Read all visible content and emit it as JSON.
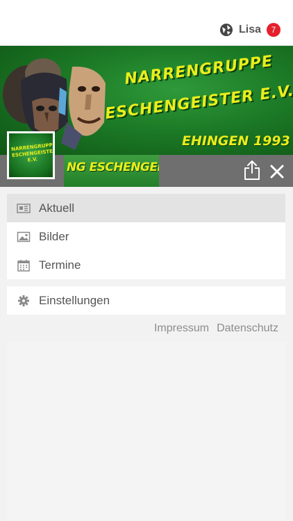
{
  "topbar": {
    "user_name": "Lisa",
    "notification_count": "7",
    "user_icon": "globe-icon"
  },
  "header": {
    "banner_line1": "NARRENGRUPPE",
    "banner_line2": "ESCHENGEISTER E.V.",
    "banner_year": "EHINGEN 1993",
    "avatar_line1": "NARRENGRUPPE",
    "avatar_line2": "ESCHENGEISTER E.V.",
    "name_banner": "NG ESCHENGEISTER",
    "share_icon": "share-icon",
    "close_icon": "close-icon"
  },
  "menu": {
    "items": [
      {
        "label": "Aktuell",
        "icon": "newspaper-icon",
        "active": true
      },
      {
        "label": "Bilder",
        "icon": "image-icon",
        "active": false
      },
      {
        "label": "Termine",
        "icon": "calendar-icon",
        "active": false
      }
    ],
    "settings": {
      "label": "Einstellungen",
      "icon": "gear-icon"
    }
  },
  "footer": {
    "impressum": "Impressum",
    "datenschutz": "Datenschutz"
  },
  "colors": {
    "banner_green": "#1c7a26",
    "banner_text": "#e9ee1c",
    "badge_red": "#e5202b",
    "bar_gray": "#6f6f6f"
  }
}
